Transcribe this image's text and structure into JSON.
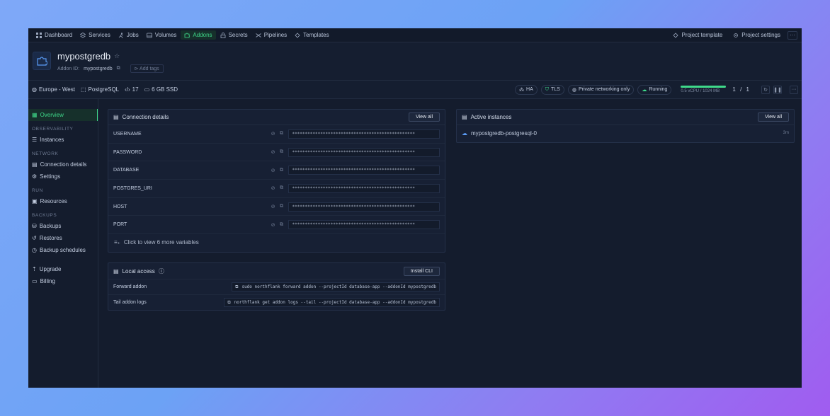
{
  "nav": {
    "items": [
      {
        "label": "Dashboard",
        "icon": "grid-icon"
      },
      {
        "label": "Services",
        "icon": "layers-icon"
      },
      {
        "label": "Jobs",
        "icon": "run-icon"
      },
      {
        "label": "Volumes",
        "icon": "drive-icon"
      },
      {
        "label": "Addons",
        "icon": "puzzle-icon"
      },
      {
        "label": "Secrets",
        "icon": "lock-icon"
      },
      {
        "label": "Pipelines",
        "icon": "shuffle-icon"
      },
      {
        "label": "Templates",
        "icon": "template-icon"
      }
    ],
    "project_template": "Project template",
    "project_settings": "Project settings",
    "more": "···"
  },
  "header": {
    "title": "mypostgredb",
    "addon_id_label": "Addon ID:",
    "addon_id": "mypostgredb",
    "add_tags": "Add tags"
  },
  "info": {
    "region": "Europe - West",
    "db_type": "PostgreSQL",
    "version": "17",
    "storage": "6 GB SSD",
    "pills": [
      "HA",
      "TLS",
      "Private networking only",
      "Running"
    ],
    "resources": "0.5 vCPU / 1024 MB",
    "instances_count": "1 / 1",
    "more": "···"
  },
  "sidebar": {
    "overview": "Overview",
    "observability_head": "OBSERVABILITY",
    "instances": "Instances",
    "network_head": "NETWORK",
    "connection_details": "Connection details",
    "settings": "Settings",
    "run_head": "RUN",
    "resources": "Resources",
    "backups_head": "BACKUPS",
    "backups": "Backups",
    "restores": "Restores",
    "backup_schedules": "Backup schedules",
    "upgrade": "Upgrade",
    "billing": "Billing"
  },
  "connection": {
    "title": "Connection details",
    "view_all": "View all",
    "rows": [
      {
        "key": "USERNAME",
        "value": "************************************************"
      },
      {
        "key": "PASSWORD",
        "value": "************************************************"
      },
      {
        "key": "DATABASE",
        "value": "************************************************"
      },
      {
        "key": "POSTGRES_URI",
        "value": "************************************************"
      },
      {
        "key": "HOST",
        "value": "************************************************"
      },
      {
        "key": "PORT",
        "value": "************************************************"
      }
    ],
    "more": "Click to view 6 more variables"
  },
  "local_access": {
    "title": "Local access",
    "install_cli": "Install CLI",
    "rows": [
      {
        "key": "Forward addon",
        "cmd": "sudo northflank forward addon --projectId database-app --addonId mypostgredb"
      },
      {
        "key": "Tail addon logs",
        "cmd": "northflank get addon logs --tail --projectId database-app --addonId mypostgredb"
      }
    ]
  },
  "active_instances": {
    "title": "Active instances",
    "view_all": "View all",
    "rows": [
      {
        "name": "mypostgredb-postgresql-0",
        "meta": "3m"
      }
    ]
  }
}
